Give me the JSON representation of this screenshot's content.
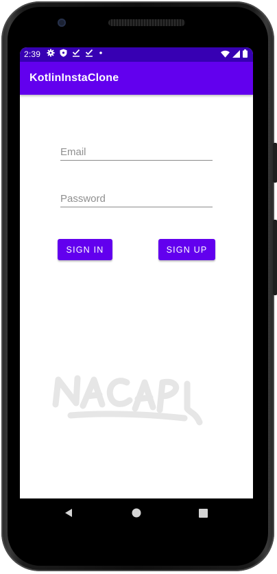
{
  "status_bar": {
    "time": "2:39",
    "left_icons": [
      "gear-icon",
      "shield-icon",
      "check-download-icon",
      "check-download-icon",
      "dot-icon"
    ],
    "right_icons": [
      "wifi-icon",
      "signal-icon",
      "battery-icon"
    ],
    "color": "#3700b3"
  },
  "app_bar": {
    "title": "KotlinInstaClone",
    "color": "#6200ee"
  },
  "form": {
    "email_placeholder": "Email",
    "email_value": "",
    "password_placeholder": "Password",
    "password_value": "",
    "sign_in_label": "SIGN IN",
    "sign_up_label": "SIGN UP"
  },
  "watermark": {
    "text": "NACAPL"
  },
  "nav_bar": {
    "buttons": [
      "back-icon",
      "home-icon",
      "recents-icon"
    ]
  },
  "colors": {
    "accent": "#6200ee",
    "status": "#3700b3"
  }
}
